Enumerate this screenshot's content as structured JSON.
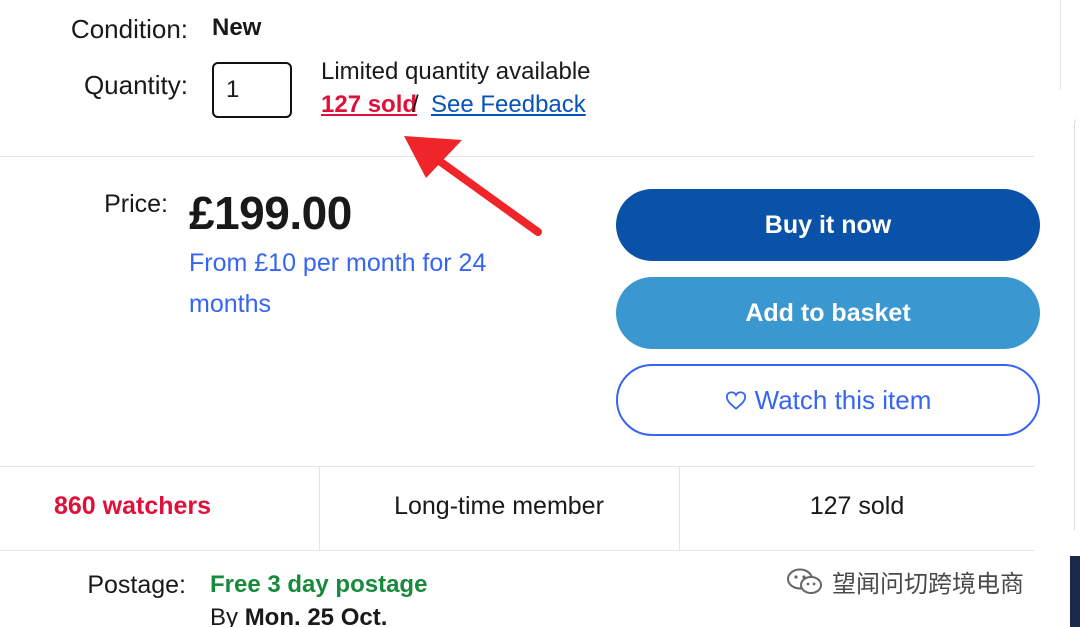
{
  "details": {
    "condition_label": "Condition:",
    "condition_value": "New",
    "quantity_label": "Quantity:",
    "quantity_value": "1",
    "availability": "Limited quantity available",
    "sold_link": "127 sold",
    "separator": "/",
    "feedback_link": "See Feedback"
  },
  "price": {
    "label": "Price:",
    "amount": "£199.00",
    "finance": "From £10 per month for 24 months"
  },
  "actions": {
    "buy_now": "Buy it now",
    "add_to_basket": "Add to basket",
    "watch": "Watch this item"
  },
  "stats": {
    "watchers": "860 watchers",
    "member": "Long-time member",
    "sold": "127 sold"
  },
  "postage": {
    "label": "Postage:",
    "value": "Free 3 day postage",
    "by_prefix": "By",
    "date": "Mon. 25 Oct."
  },
  "watermark": {
    "text": "望闻问切跨境电商"
  },
  "colors": {
    "accent_blue": "#3665f3",
    "buy_button": "#0a52a8",
    "basket_button": "#3b97cf",
    "alert_red": "#e0103a",
    "postage_green": "#188a3c",
    "annotation_arrow": "#f0252a"
  },
  "icons": {
    "watch_icon": "heart-outline-icon",
    "annotation": "red-arrow-icon",
    "watermark_icon": "wechat-icon"
  }
}
